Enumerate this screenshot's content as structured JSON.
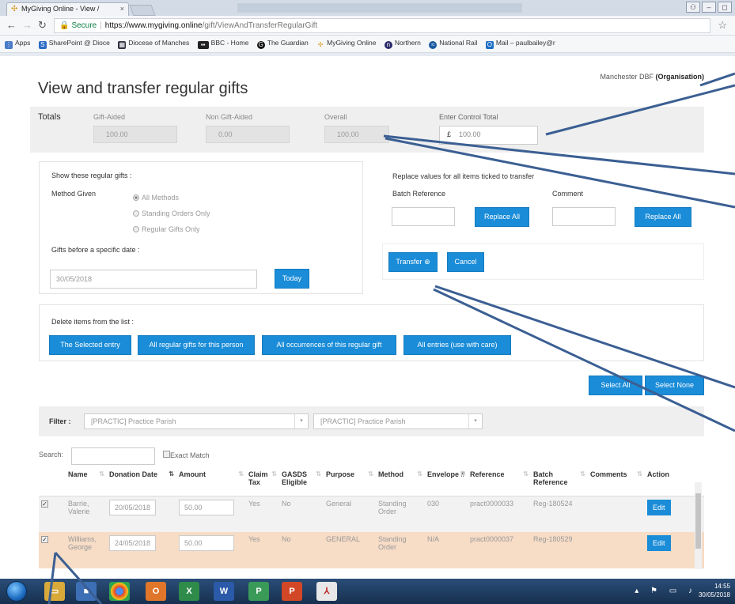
{
  "browser": {
    "tab_title": "MyGiving Online - View /",
    "tab_close": "×",
    "url_secure": "Secure",
    "url_host": "https://www.mygiving.online",
    "url_path": "/gift/ViewAndTransferRegularGift",
    "bookmarks": [
      {
        "label": "Apps",
        "color": "#4a7cc7"
      },
      {
        "label": "SharePoint @ Dioce",
        "color": "#2b6cc4"
      },
      {
        "label": "Diocese of Manches",
        "color": "#334"
      },
      {
        "label": "BBC - Home",
        "color": "#222"
      },
      {
        "label": "The Guardian",
        "color": "#111"
      },
      {
        "label": "MyGiving Online",
        "color": "#d99a1c"
      },
      {
        "label": "Northern",
        "color": "#2a2a6a"
      },
      {
        "label": "National Rail",
        "color": "#1a5aa0"
      },
      {
        "label": "Mail – paulbailey@r",
        "color": "#1f6fc5"
      }
    ]
  },
  "header": {
    "org_name": "Manchester DBF",
    "org_type": "(Organisation)",
    "title": "View and transfer regular gifts"
  },
  "totals": {
    "label": "Totals",
    "gift_aided_label": "Gift-Aided",
    "gift_aided_value": "100.00",
    "non_gift_aided_label": "Non Gift-Aided",
    "non_gift_aided_value": "0.00",
    "overall_label": "Overall",
    "overall_value": "100.00",
    "control_label": "Enter Control Total",
    "currency": "£",
    "control_value": "100.00"
  },
  "filters": {
    "show_label": "Show these regular gifts :",
    "method_label": "Method Given",
    "methods": [
      "All Methods",
      "Standing Orders Only",
      "Regular Gifts Only"
    ],
    "date_label": "Gifts before a specific date :",
    "date_value": "30/05/2018",
    "today_button": "Today"
  },
  "replace": {
    "heading": "Replace values for all items ticked to transfer",
    "batch_label": "Batch Reference",
    "comment_label": "Comment",
    "replace_all_1": "Replace All",
    "replace_all_2": "Replace All",
    "transfer_button": "Transfer",
    "cancel_button": "Cancel"
  },
  "delete": {
    "heading": "Delete items from the list :",
    "buttons": [
      "The Selected entry",
      "All regular gifts for this person",
      "All occurrences of this regular gift",
      "All entries (use with care)"
    ]
  },
  "selection": {
    "select_all": "Select All",
    "select_none": "Select None"
  },
  "filterbar": {
    "label": "Filter :",
    "select_1": "[PRACTIC] Practice Parish",
    "select_2": "[PRACTIC] Practice Parish"
  },
  "search": {
    "label": "Search:",
    "exact_match": "Exact Match"
  },
  "table": {
    "columns": [
      "Name",
      "Donation Date",
      "Amount",
      "Claim Tax",
      "GASDS Eligible",
      "Purpose",
      "Method",
      "Envelope #",
      "Reference",
      "Batch Reference",
      "Comments",
      "Action"
    ],
    "rows": [
      {
        "name": "Barrie, Valerie",
        "date": "20/05/2018",
        "amount": "50.00",
        "claim_tax": "Yes",
        "gasds": "No",
        "purpose": "General",
        "method": "Standing Order",
        "envelope": "030",
        "reference": "pract0000033",
        "batch": "Reg-180524",
        "comments": "",
        "action": "Edit"
      },
      {
        "name": "Williams, George",
        "date": "24/05/2018",
        "amount": "50.00",
        "claim_tax": "Yes",
        "gasds": "No",
        "purpose": "GENERAL",
        "method": "Standing Order",
        "envelope": "N/A",
        "reference": "pract0000037",
        "batch": "Reg-180529",
        "comments": "",
        "action": "Edit"
      }
    ]
  },
  "taskbar": {
    "time": "14:55",
    "date": "30/05/2018"
  }
}
